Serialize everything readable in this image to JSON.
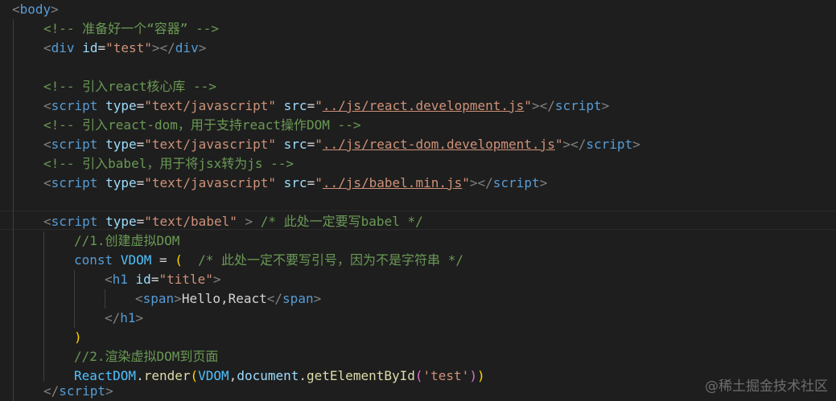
{
  "editor": {
    "background": "#1e1e1e",
    "colors": {
      "tag": "#569cd6",
      "bracket": "#808080",
      "attribute": "#9cdcfe",
      "string": "#ce9178",
      "comment": "#6a9955",
      "keyword": "#569cd6",
      "variable": "#4fc1ff",
      "function": "#dcdcaa",
      "paren": "#ffd700",
      "paren_nested": "#da70d6"
    },
    "lines": [
      {
        "segments": [
          "<",
          "body",
          ">"
        ]
      },
      {
        "segments": [
          "<!-- 准备好一个“容器” -->"
        ]
      },
      {
        "segments": [
          "<",
          "div",
          " ",
          "id",
          "=",
          "\"test\"",
          "></",
          "div",
          ">"
        ]
      },
      {
        "segments": []
      },
      {
        "segments": [
          "<!-- 引入react核心库 -->"
        ]
      },
      {
        "segments": [
          "<",
          "script",
          " ",
          "type",
          "=",
          "\"text/javascript\"",
          " ",
          "src",
          "=",
          "\"",
          "../js/react.development.js",
          "\"",
          "></",
          "script",
          ">"
        ]
      },
      {
        "segments": [
          "<!-- 引入react-dom，用于支持react操作DOM -->"
        ]
      },
      {
        "segments": [
          "<",
          "script",
          " ",
          "type",
          "=",
          "\"text/javascript\"",
          " ",
          "src",
          "=",
          "\"",
          "../js/react-dom.development.js",
          "\"",
          "></",
          "script",
          ">"
        ]
      },
      {
        "segments": [
          "<!-- 引入babel，用于将jsx转为js -->"
        ]
      },
      {
        "segments": [
          "<",
          "script",
          " ",
          "type",
          "=",
          "\"text/javascript\"",
          " ",
          "src",
          "=",
          "\"",
          "../js/babel.min.js",
          "\"",
          "></",
          "script",
          ">"
        ]
      },
      {
        "segments": []
      },
      {
        "segments": [
          "<",
          "script",
          " ",
          "type",
          "=",
          "\"text/babel\"",
          " ",
          ">",
          " ",
          "/* 此处一定要写babel */"
        ]
      },
      {
        "segments": [
          "//1.创建虚拟DOM"
        ]
      },
      {
        "segments": [
          "const",
          " ",
          "VDOM",
          " = ",
          "(",
          "  ",
          "/* 此处一定不要写引号，因为不是字符串 */"
        ]
      },
      {
        "segments": [
          "<",
          "h1",
          " ",
          "id",
          "=",
          "\"title\"",
          ">"
        ]
      },
      {
        "segments": [
          "<",
          "span",
          ">",
          "Hello,React",
          "</",
          "span",
          ">"
        ]
      },
      {
        "segments": [
          "</",
          "h1",
          ">"
        ]
      },
      {
        "segments": [
          ")"
        ]
      },
      {
        "segments": [
          "//2.渲染虚拟DOM到页面"
        ]
      },
      {
        "segments": [
          "ReactDOM",
          ".",
          "render",
          "(",
          "VDOM",
          ",",
          "document",
          ".",
          "getElementById",
          "(",
          "'test'",
          ")",
          ")"
        ]
      },
      {
        "segments": [
          "</",
          "script",
          ">"
        ]
      }
    ]
  },
  "watermark": "@稀土掘金技术社区"
}
